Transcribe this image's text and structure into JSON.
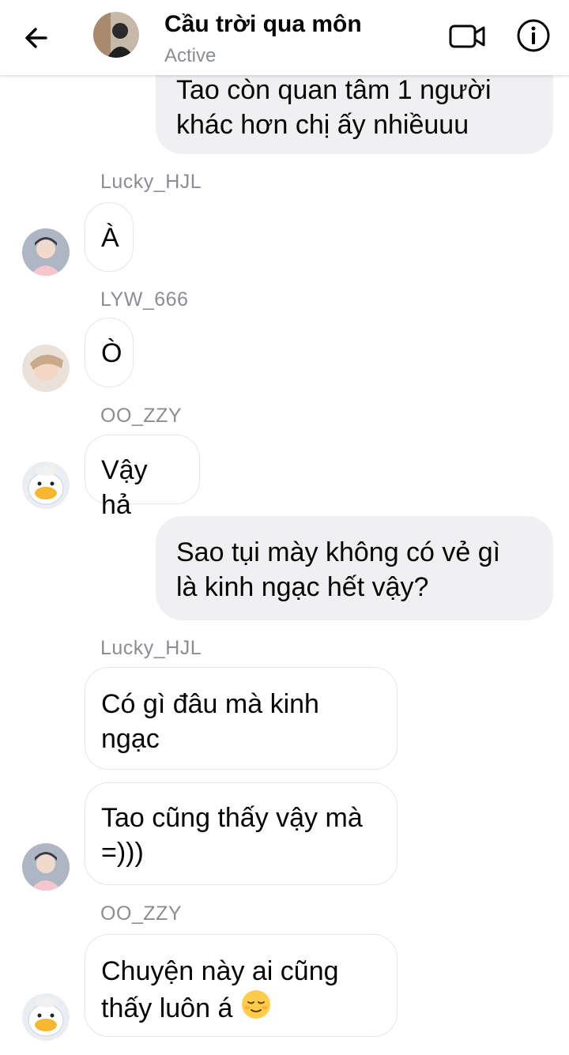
{
  "header": {
    "title": "Cầu trời qua môn",
    "status": "Active",
    "back_icon": "arrow-left-icon",
    "video_icon": "video-call-icon",
    "info_icon": "info-icon"
  },
  "messages": {
    "m1_line1": "Tao còn quan tâm 1 người",
    "m1_line2": "khác hơn chị ấy nhiềuuu",
    "s1": "Lucky_HJL",
    "m2": "À",
    "s2": "LYW_666",
    "m3": "Ò",
    "s3": "OO_ZZY",
    "m4": "Vậy hả",
    "m5_line1": "Sao tụi mày không có vẻ gì",
    "m5_line2": "là kinh ngạc hết vậy?",
    "s4": "Lucky_HJL",
    "m6_line1": "Có gì đâu mà kinh",
    "m6_line2": "ngạc",
    "m7_line1": "Tao cũng thấy vậy mà",
    "m7_line2": "=)))",
    "s5": "OO_ZZY",
    "m8_line1": "Chuyện này ai cũng",
    "m8_line2": "thấy luôn á",
    "m8_emoji": "relieved-face-emoji"
  },
  "colors": {
    "outgoing_bubble": "#f0f0f2",
    "incoming_border": "#e4e6eb",
    "secondary_text": "#8a8d91"
  }
}
